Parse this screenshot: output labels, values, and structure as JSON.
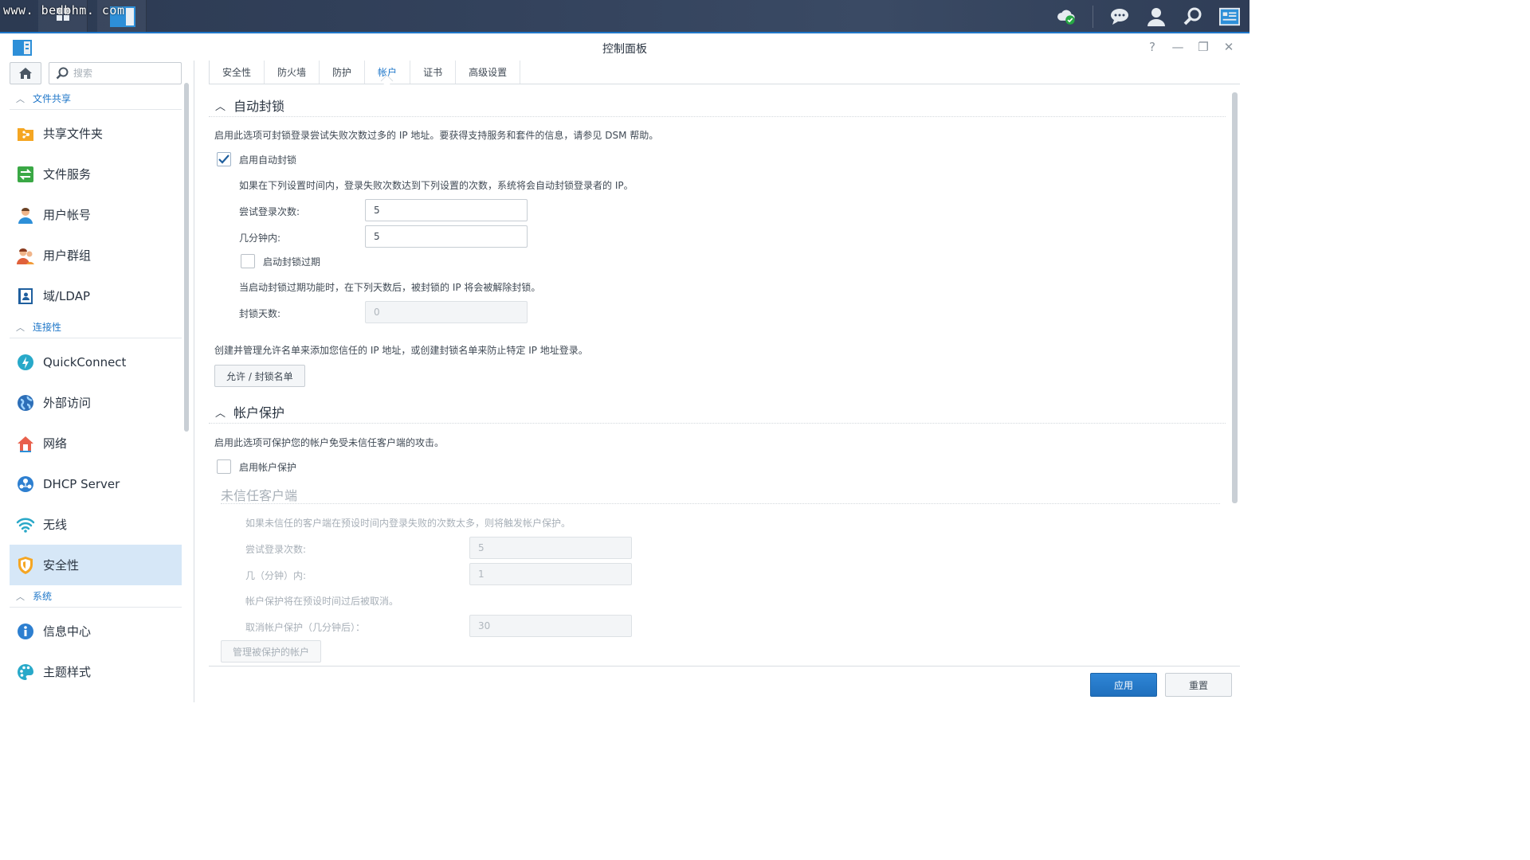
{
  "watermark": "www. bedbhm. com",
  "window": {
    "title": "控制面板",
    "controls": [
      "?",
      "—",
      "❐",
      "✕"
    ]
  },
  "sidebar": {
    "search_placeholder": "搜索",
    "groups": [
      {
        "label": "文件共享",
        "items": [
          {
            "label": "共享文件夹",
            "icon": "shared-folder-icon"
          },
          {
            "label": "文件服务",
            "icon": "file-services-icon"
          },
          {
            "label": "用户帐号",
            "icon": "user-account-icon"
          },
          {
            "label": "用户群组",
            "icon": "user-group-icon"
          },
          {
            "label": "域/LDAP",
            "icon": "domain-ldap-icon"
          }
        ]
      },
      {
        "label": "连接性",
        "items": [
          {
            "label": "QuickConnect",
            "icon": "quickconnect-icon"
          },
          {
            "label": "外部访问",
            "icon": "external-access-icon"
          },
          {
            "label": "网络",
            "icon": "network-icon"
          },
          {
            "label": "DHCP Server",
            "icon": "dhcp-server-icon"
          },
          {
            "label": "无线",
            "icon": "wireless-icon"
          },
          {
            "label": "安全性",
            "icon": "security-shield-icon",
            "active": true
          }
        ]
      },
      {
        "label": "系统",
        "items": [
          {
            "label": "信息中心",
            "icon": "info-center-icon"
          },
          {
            "label": "主题样式",
            "icon": "theme-palette-icon"
          }
        ]
      }
    ]
  },
  "tabs": [
    "安全性",
    "防火墙",
    "防护",
    "帐户",
    "证书",
    "高级设置"
  ],
  "active_tab": "帐户",
  "auto_block": {
    "title": "自动封锁",
    "desc": "启用此选项可封锁登录尝试失败次数过多的 IP 地址。要获得支持服务和套件的信息，请参见 DSM 帮助。",
    "enable_label": "启用自动封锁",
    "enable_checked": true,
    "rule_desc": "如果在下列设置时间内，登录失败次数达到下列设置的次数，系统将会自动封锁登录者的 IP。",
    "attempts_label": "尝试登录次数:",
    "attempts_value": "5",
    "minutes_label": "几分钟内:",
    "minutes_value": "5",
    "expire_label": "启动封锁过期",
    "expire_checked": false,
    "expire_desc": "当启动封锁过期功能时，在下列天数后，被封锁的 IP 将会被解除封锁。",
    "days_label": "封锁天数:",
    "days_value": "0",
    "allow_desc": "创建并管理允许名单来添加您信任的 IP 地址，或创建封锁名单来防止特定 IP 地址登录。",
    "allow_button": "允许 / 封锁名单"
  },
  "account_protection": {
    "title": "帐户保护",
    "desc": "启用此选项可保护您的帐户免受未信任客户端的攻击。",
    "enable_label": "启用帐户保护",
    "enable_checked": false,
    "untrusted_title": "未信任客户端",
    "untrusted_desc": "如果未信任的客户端在预设时间内登录失败的次数太多，则将触发帐户保护。",
    "attempts_label": "尝试登录次数:",
    "attempts_value": "5",
    "minutes_label": "几（分钟）内:",
    "minutes_value": "1",
    "cancel_desc": "帐户保护将在预设时间过后被取消。",
    "cancel_label": "取消帐户保护（几分钟后）：",
    "cancel_value": "30",
    "manage_button": "管理被保护的帐户"
  },
  "footer": {
    "apply": "应用",
    "reset": "重置"
  },
  "colors": {
    "accent": "#1f77c9",
    "sidebar_active": "#d6e7f7",
    "taskbar": "#33425c"
  }
}
